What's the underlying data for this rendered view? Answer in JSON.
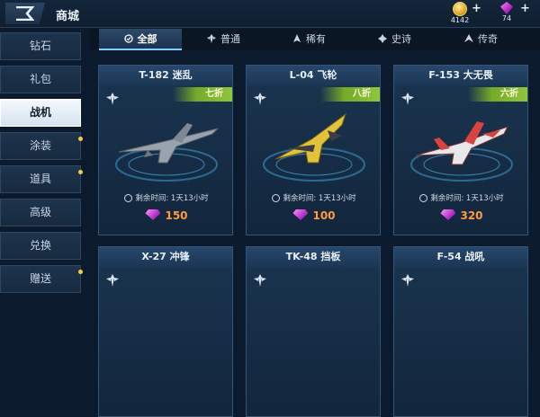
{
  "header": {
    "title": "商城",
    "coins": "4142",
    "gems": "74",
    "plus": "+"
  },
  "sidebar": {
    "items": [
      {
        "label": "钻石",
        "active": false,
        "dot": false
      },
      {
        "label": "礼包",
        "active": false,
        "dot": false
      },
      {
        "label": "战机",
        "active": true,
        "dot": false
      },
      {
        "label": "涂装",
        "active": false,
        "dot": true
      },
      {
        "label": "道具",
        "active": false,
        "dot": true
      },
      {
        "label": "高级",
        "active": false,
        "dot": false
      },
      {
        "label": "兑换",
        "active": false,
        "dot": false
      },
      {
        "label": "赠送",
        "active": false,
        "dot": true
      }
    ]
  },
  "tabs": [
    {
      "label": "全部",
      "active": true
    },
    {
      "label": "普通",
      "active": false
    },
    {
      "label": "稀有",
      "active": false
    },
    {
      "label": "史诗",
      "active": false
    },
    {
      "label": "传奇",
      "active": false
    }
  ],
  "cards": [
    {
      "name": "T-182 迷乱",
      "discount": "七折",
      "timer": "剩余时间: 1天13小时",
      "price": "150",
      "jet_color": "#9aa3ad"
    },
    {
      "name": "L-04 飞轮",
      "discount": "八折",
      "timer": "剩余时间: 1天13小时",
      "price": "100",
      "jet_color": "#e2c23a"
    },
    {
      "name": "F-153 大无畏",
      "discount": "六折",
      "timer": "剩余时间: 1天13小时",
      "price": "320",
      "jet_color": "#d9423e"
    },
    {
      "name": "X-27 冲锋"
    },
    {
      "name": "TK-48 挡板"
    },
    {
      "name": "F-54 战吼"
    }
  ],
  "colors": {
    "accent": "#7fd0ff",
    "discount": "#8fc43b",
    "price": "#ff9b3d"
  }
}
